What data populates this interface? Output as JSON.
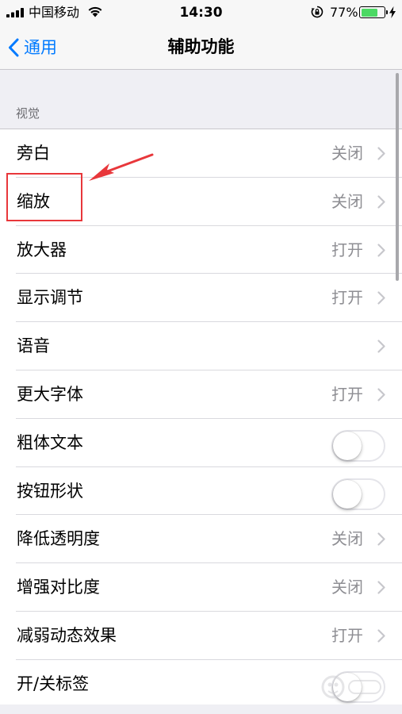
{
  "status_bar": {
    "carrier": "中国移动",
    "time": "14:30",
    "battery_percent": "77%",
    "battery_level": 0.77,
    "battery_color": "#4cd964",
    "icons": [
      "signal-icon",
      "wifi-icon",
      "orientation-lock-icon",
      "battery-icon",
      "charging-bolt-icon"
    ]
  },
  "nav": {
    "back_label": "通用",
    "title": "辅助功能",
    "accent": "#007aff"
  },
  "section": {
    "header": "视觉"
  },
  "rows": [
    {
      "label": "旁白",
      "value": "关闭",
      "kind": "disclosure"
    },
    {
      "label": "缩放",
      "value": "关闭",
      "kind": "disclosure"
    },
    {
      "label": "放大器",
      "value": "打开",
      "kind": "disclosure"
    },
    {
      "label": "显示调节",
      "value": "打开",
      "kind": "disclosure"
    },
    {
      "label": "语音",
      "value": "",
      "kind": "disclosure"
    },
    {
      "label": "更大字体",
      "value": "打开",
      "kind": "disclosure"
    },
    {
      "label": "粗体文本",
      "kind": "toggle",
      "on": false
    },
    {
      "label": "按钮形状",
      "kind": "toggle",
      "on": false
    },
    {
      "label": "降低透明度",
      "value": "关闭",
      "kind": "disclosure"
    },
    {
      "label": "增强对比度",
      "value": "关闭",
      "kind": "disclosure"
    },
    {
      "label": "减弱动态效果",
      "value": "打开",
      "kind": "disclosure"
    },
    {
      "label": "开/关标签",
      "kind": "toggle",
      "on": false
    }
  ],
  "annotation": {
    "color": "#e8373b",
    "icons": [
      "highlight-box",
      "arrow-icon"
    ]
  }
}
